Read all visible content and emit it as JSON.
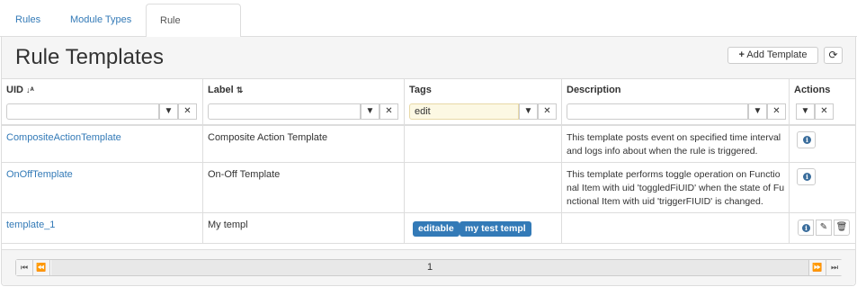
{
  "tabs": [
    {
      "label": "Rules"
    },
    {
      "label": "Module Types"
    },
    {
      "label": "Rule Templates"
    }
  ],
  "header": {
    "title": "Rule Templates",
    "add_label": "Add Template",
    "add_icon": "+",
    "refresh_icon": "⟳"
  },
  "columns": [
    {
      "label": "UID",
      "sort_icon": "↓ᴬ",
      "filter": ""
    },
    {
      "label": "Label",
      "sort_icon": "⇅",
      "filter": ""
    },
    {
      "label": "Tags",
      "sort_icon": "",
      "filter": "edit"
    },
    {
      "label": "Description",
      "sort_icon": "",
      "filter": ""
    },
    {
      "label": "Actions",
      "sort_icon": "",
      "filter": ""
    }
  ],
  "rows": [
    {
      "uid": "CompositeActionTemplate",
      "label": "Composite Action Template",
      "description": "This template posts event on specified time interval and logs info about when the rule is triggered."
    },
    {
      "uid": "OnOffTemplate",
      "label": "On-Off Template",
      "description": "This template performs toggle operation on Functional Item with uid 'toggledFiUID' when the state of Functional Item with uid 'triggerFIUID' is changed."
    },
    {
      "uid": "template_1",
      "label": "My templ",
      "tags": [
        "editable",
        "my test templ"
      ],
      "description": ""
    }
  ],
  "pager": {
    "page": "1"
  },
  "colors": {
    "accent": "#337ab7",
    "filter_active_bg": "#fcf8e3"
  }
}
